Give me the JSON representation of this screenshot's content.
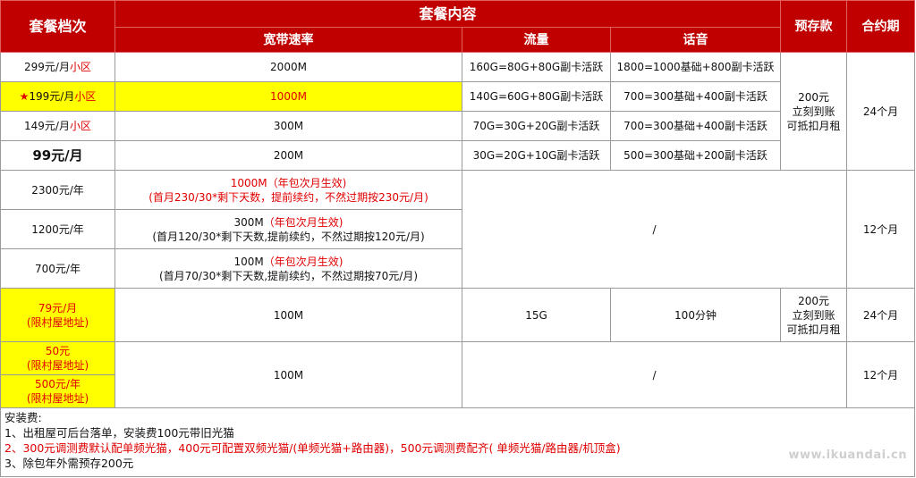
{
  "header": {
    "tier": "套餐档次",
    "content": "套餐内容",
    "bandwidth": "宽带速率",
    "traffic": "流量",
    "voice": "话音",
    "deposit": "预存款",
    "contract": "合约期"
  },
  "rows": [
    {
      "price": "299元/月",
      "suffix": "小区",
      "bandwidth": "2000M",
      "traffic": "160G=80G+80G副卡活跃",
      "voice": "1800=1000基础+800副卡活跃"
    },
    {
      "star": "★",
      "price": "199元/月",
      "suffix": "小区",
      "bandwidth": "1000M",
      "traffic": "140G=60G+80G副卡活跃",
      "voice": "700=300基础+400副卡活跃"
    },
    {
      "price": "149元/月",
      "suffix": "小区",
      "bandwidth": "300M",
      "traffic": "70G=30G+20G副卡活跃",
      "voice": "700=300基础+400副卡活跃"
    },
    {
      "price": "99元/月",
      "bandwidth": "200M",
      "traffic": "30G=20G+10G副卡活跃",
      "voice": "500=300基础+200副卡活跃"
    }
  ],
  "deposit1": {
    "line1": "200元",
    "line2": "立刻到账",
    "line3": "可抵扣月租"
  },
  "contract1": "24个月",
  "yearly": [
    {
      "price": "2300元/年",
      "line1": "1000M（年包次月生效)",
      "line2": "(首月230/30*剩下天数，提前续约，不然过期按230元/月)"
    },
    {
      "price": "1200元/年",
      "line1a": "300M",
      "line1b": "（年包次月生效)",
      "line2": "(首月120/30*剩下天数,提前续约，不然过期按120元/月)"
    },
    {
      "price": "700元/年",
      "line1a": "100M",
      "line1b": "（年包次月生效)",
      "line2": "(首月70/30*剩下天数,提前续约，不然过期按70元/月)"
    }
  ],
  "yearly_slash": "/",
  "contract2": "12个月",
  "village": {
    "price": "79元/月",
    "note": "(限村屋地址)",
    "bandwidth": "100M",
    "traffic": "15G",
    "voice": "100分钟"
  },
  "deposit2": {
    "line1": "200元",
    "line2": "立刻到账",
    "line3": "可抵扣月租"
  },
  "contract3": "24个月",
  "village_b": [
    {
      "price": "50元",
      "note": "(限村屋地址)"
    },
    {
      "price": "500元/年",
      "note": "(限村屋地址)"
    }
  ],
  "village_b_bandwidth": "100M",
  "village_b_slash": "/",
  "contract4": "12个月",
  "notes": {
    "title": "安装费:",
    "n1": "1、出租屋可后台落单，安装费100元带旧光猫",
    "n2": "2、300元调测费默认配单频光猫，400元可配置双频光猫/(单频光猫+路由器)，500元调测费配齐( 单频光猫/路由器/机顶盒)",
    "n3": "3、除包年外需预存200元"
  },
  "watermark": "www.ikuandai.cn",
  "colors": {
    "header_bg": "#c00000",
    "highlight": "#ffff00",
    "accent_red": "#e00000"
  }
}
